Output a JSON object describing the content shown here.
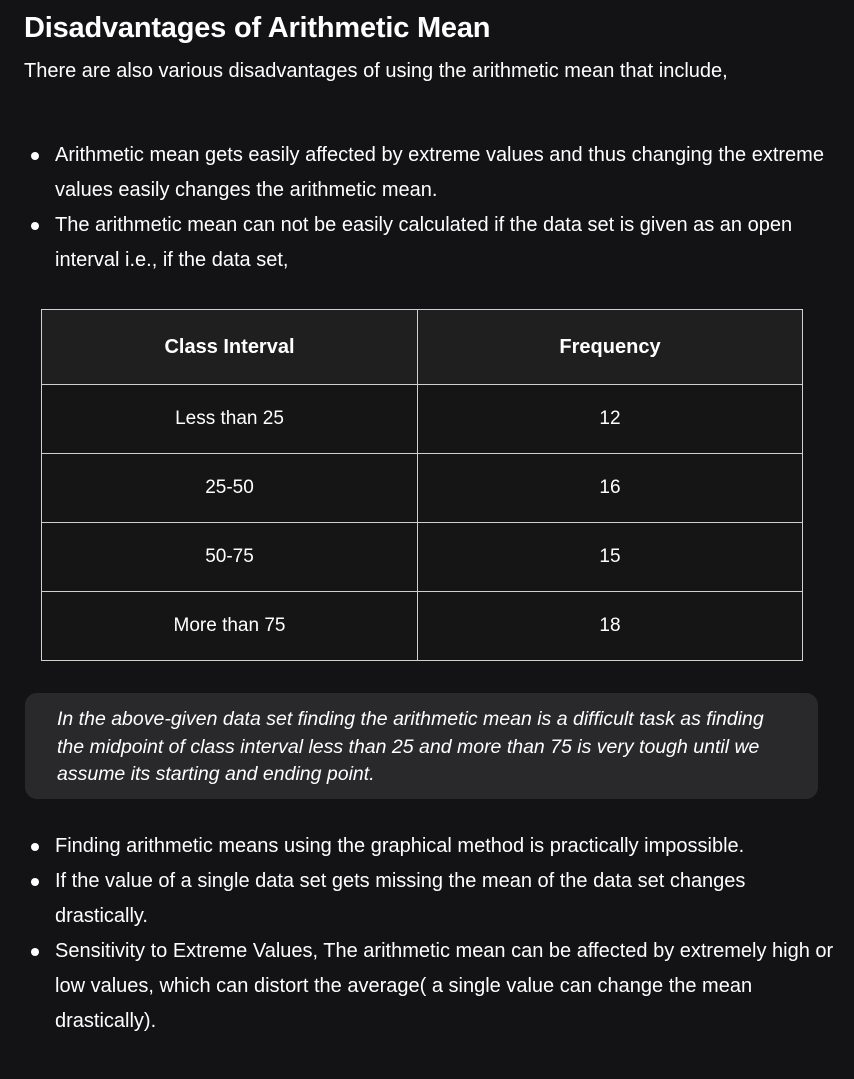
{
  "heading": "Disadvantages of Arithmetic Mean",
  "intro": "There are also various disadvantages of using the arithmetic mean that include,",
  "bullets_top": [
    "Arithmetic mean gets easily affected by extreme values and thus changing the extreme values easily changes the arithmetic mean.",
    "The arithmetic mean can not be easily calculated if the data set is given as an open interval i.e., if the data set,"
  ],
  "table": {
    "headers": [
      "Class Interval",
      "Frequency"
    ],
    "rows": [
      [
        "Less than 25",
        "12"
      ],
      [
        "25-50",
        "16"
      ],
      [
        "50-75",
        "15"
      ],
      [
        "More than 75",
        "18"
      ]
    ]
  },
  "note": "In the above-given data set finding the arithmetic mean is a difficult task as finding the midpoint of class interval less than 25 and more than 75 is very tough until we assume its starting and ending point.",
  "bullets_bottom": [
    "Finding arithmetic means using the graphical method is practically impossible.",
    "If the value of a single data set gets missing the mean of the data set changes drastically.",
    "Sensitivity to Extreme Values, The arithmetic mean can be affected by extremely high or low values, which can distort the average( a single value can change the mean drastically)."
  ]
}
